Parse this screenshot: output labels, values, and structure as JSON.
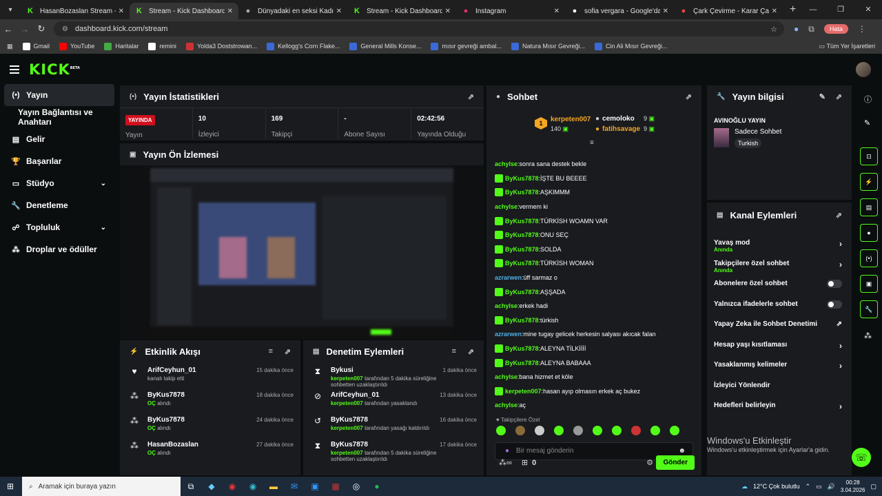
{
  "browser": {
    "tabs": [
      {
        "title": "HasanBozaslan Stream - Watch",
        "icon": "kick-icon",
        "color": "#53fc18"
      },
      {
        "title": "Stream - Kick Dashboard",
        "icon": "kick-icon",
        "color": "#53fc18",
        "active": true
      },
      {
        "title": "Dünyadaki en seksi Kadın kim",
        "icon": "chat-ai-icon",
        "color": "#aaaaaa"
      },
      {
        "title": "Stream - Kick Dashboard",
        "icon": "kick-icon",
        "color": "#53fc18"
      },
      {
        "title": "Instagram",
        "icon": "instagram-icon",
        "color": "#e1306c"
      },
      {
        "title": "sofia vergara - Google'da Ara",
        "icon": "google-icon",
        "color": "#ffffff"
      },
      {
        "title": "Çark Çevirme - Karar Çarkı!",
        "icon": "wheel-icon",
        "color": "#e74c3c"
      }
    ],
    "url": "dashboard.kick.com/stream",
    "profile_label": "Hata",
    "bookmarks": [
      "Gmail",
      "YouTube",
      "Haritalar",
      "remini",
      "Yolda3 Doststrowan...",
      "Kellogg's Corn Flake...",
      "General Mills Konse...",
      "mısır gevreği ambal...",
      "Natura Mısır Gevreği...",
      "Cin Ali Mısır Gevreği..."
    ],
    "bookmarks_all": "Tüm Yer İşaretleri"
  },
  "sidebar": {
    "items": [
      {
        "label": "Yayın",
        "icon": "broadcast-icon",
        "active": true
      },
      {
        "label": "Yayın Bağlantısı ve Anahtarı",
        "icon": ""
      },
      {
        "label": "Gelir",
        "icon": "revenue-icon"
      },
      {
        "label": "Başarılar",
        "icon": "trophy-icon"
      },
      {
        "label": "Stüdyo",
        "icon": "studio-icon",
        "chevron": true
      },
      {
        "label": "Denetleme",
        "icon": "wrench-icon"
      },
      {
        "label": "Topluluk",
        "icon": "community-icon",
        "chevron": true
      },
      {
        "label": "Droplar ve ödüller",
        "icon": "drops-icon"
      }
    ]
  },
  "stats": {
    "title": "Yayın İstatistikleri",
    "live": "YAYINDA",
    "live_label": "Yayın",
    "viewers": "10",
    "viewers_label": "İzleyici",
    "followers": "169",
    "followers_label": "Takipçi",
    "subs": "-",
    "subs_label": "Abone Sayısı",
    "uptime": "02:42:56",
    "uptime_label": "Yayında Olduğu"
  },
  "preview": {
    "title": "Yayın Ön İzlemesi"
  },
  "activity": {
    "title": "Etkinlik Akışı",
    "items": [
      {
        "name": "ArifCeyhun_01",
        "sub": "kanalı takip etti",
        "time": "15 dakika önce",
        "icon": "heart-icon"
      },
      {
        "name": "ByKus7878",
        "sub": "OÇ alındı",
        "time": "18 dakika önce",
        "icon": "drops-icon"
      },
      {
        "name": "ByKus7878",
        "sub": "OÇ alındı",
        "time": "24 dakika önce",
        "icon": "drops-icon"
      },
      {
        "name": "HasanBozaslan",
        "sub": "OÇ alındı",
        "time": "27 dakika önce",
        "icon": "drops-icon"
      }
    ]
  },
  "modlog": {
    "title": "Denetim Eylemleri",
    "items": [
      {
        "name": "Bykusi",
        "actor": "kerpeten007",
        "sub": "tarafından 5 dakika süreliğine sohbetten uzaklaştırıldı",
        "time": "1 dakika önce",
        "icon": "hourglass-icon"
      },
      {
        "name": "ArifCeyhun_01",
        "actor": "kerpeten007",
        "sub": "tarafından yasaklandı",
        "time": "13 dakika önce",
        "icon": "ban-icon"
      },
      {
        "name": "ByKus7878",
        "actor": "kerpeten007",
        "sub": "tarafından yasağı kaldırıldı",
        "time": "16 dakika önce",
        "icon": "undo-icon"
      },
      {
        "name": "ByKus7878",
        "actor": "kerpeten007",
        "sub": "tarafından 5 dakika süreliğine sohbetten uzaklaştırıldı",
        "time": "17 dakika önce",
        "icon": "hourglass-icon"
      }
    ]
  },
  "chat": {
    "title": "Sohbet",
    "top1": {
      "name": "kerpeten007",
      "count": "140",
      "rank": "1"
    },
    "top2": {
      "name": "cemoloko",
      "count": "9"
    },
    "top3": {
      "name": "fatihsavage",
      "count": "9"
    },
    "messages": [
      {
        "user": "achylse",
        "text": "sonra sana destek bekle",
        "color": "#53fc18",
        "badge": false
      },
      {
        "user": "ByKus7878",
        "text": "İŞTE BU BEEEE",
        "color": "#53fc18",
        "badge": true
      },
      {
        "user": "ByKus7878",
        "text": "AŞKIMMM",
        "color": "#53fc18",
        "badge": true
      },
      {
        "user": "achylse",
        "text": "vermem ki",
        "color": "#53fc18",
        "badge": false
      },
      {
        "user": "ByKus7878",
        "text": "TÜRKİSH WOAMN VAR",
        "color": "#53fc18",
        "badge": true
      },
      {
        "user": "ByKus7878",
        "text": "ONU SEÇ",
        "color": "#53fc18",
        "badge": true
      },
      {
        "user": "ByKus7878",
        "text": "SOLDA",
        "color": "#53fc18",
        "badge": true
      },
      {
        "user": "ByKus7878",
        "text": "TÜRKİSH WOMAN",
        "color": "#53fc18",
        "badge": true
      },
      {
        "user": "azrarwen",
        "text": "üff sarmaz o",
        "color": "#4fb0e5",
        "badge": false
      },
      {
        "user": "ByKus7878",
        "text": "AŞŞADA",
        "color": "#53fc18",
        "badge": true
      },
      {
        "user": "achylse",
        "text": "erkek hadi",
        "color": "#53fc18",
        "badge": false
      },
      {
        "user": "ByKus7878",
        "text": "türkish",
        "color": "#53fc18",
        "badge": true
      },
      {
        "user": "azrarwen",
        "text": "mine tugay gelicek herkesin salyası akıcak falan",
        "color": "#4fb0e5",
        "badge": false
      },
      {
        "user": "ByKus7878",
        "text": "ALEYNA TİLKİİİİ",
        "color": "#53fc18",
        "badge": true
      },
      {
        "user": "ByKus7878",
        "text": "ALEYNA BABAAA",
        "color": "#53fc18",
        "badge": true
      },
      {
        "user": "achylse",
        "text": "bana hizmet et köle",
        "color": "#53fc18",
        "badge": false
      },
      {
        "user": "kerpeten007",
        "text": "hasan ayıp olmasın erkek aç bukez",
        "color": "#53fc18",
        "badge": true
      },
      {
        "user": "achylse",
        "text": "aç",
        "color": "#53fc18",
        "badge": false
      }
    ],
    "followers_only": "Takipçilere Özel",
    "placeholder": "Bir mesaj gönderin",
    "points": "0",
    "send": "Gönder"
  },
  "info": {
    "title": "Yayın bilgisi",
    "stream_title": "AVINOĞLU YAYIN",
    "category": "Sadece Sohbet",
    "tag": "Turkish"
  },
  "actions": {
    "title": "Kanal Eylemleri",
    "items": [
      {
        "label": "Yavaş mod",
        "sub": "Anında",
        "type": "chev"
      },
      {
        "label": "Takipçilere özel sohbet",
        "sub": "Anında",
        "type": "chev"
      },
      {
        "label": "Abonelere özel sohbet",
        "sub": "",
        "type": "toggle"
      },
      {
        "label": "Yalnızca ifadelerle sohbet",
        "sub": "",
        "type": "toggle"
      },
      {
        "label": "Yapay Zeka ile Sohbet Denetimi",
        "sub": "",
        "type": "ext"
      },
      {
        "label": "Hesap yaşı kısıtlaması",
        "sub": "",
        "type": "chev"
      },
      {
        "label": "Yasaklanmış kelimeler",
        "sub": "",
        "type": "chev"
      },
      {
        "label": "İzleyici Yönlendir",
        "sub": "",
        "type": "none"
      },
      {
        "label": "Hedefleri belirleyin",
        "sub": "",
        "type": "chev"
      }
    ]
  },
  "watermark": {
    "line1": "Windows'u Etkinleştir",
    "line2": "Windows'u etkinleştirmek için Ayarlar'a gidin."
  },
  "taskbar": {
    "search": "Aramak için buraya yazın",
    "weather": "12°C  Çok bulutlu",
    "time": "00:28",
    "date": "3.04.2026"
  }
}
